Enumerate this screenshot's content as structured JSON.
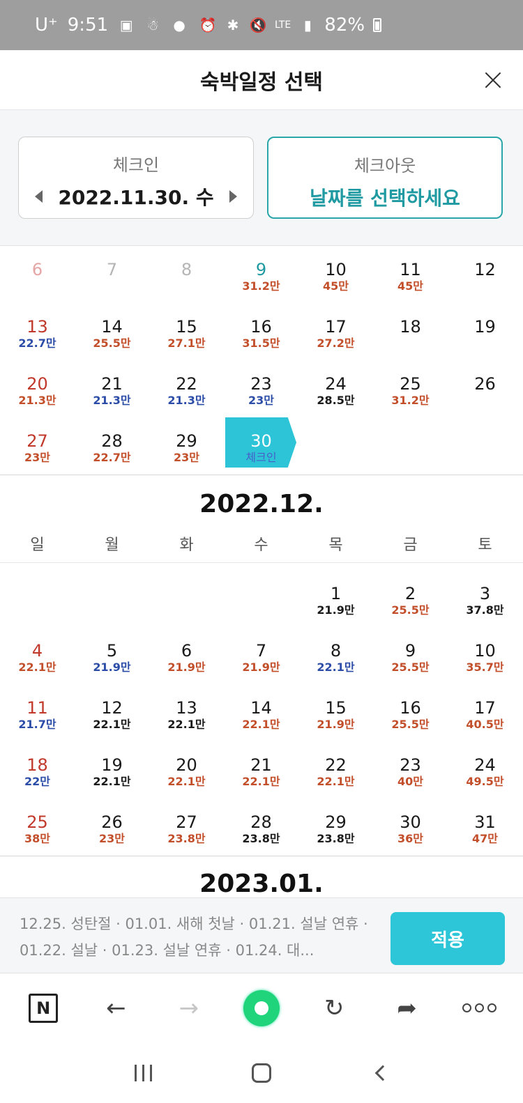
{
  "status_bar": {
    "carrier": "U⁺",
    "time": "9:51",
    "network": "LTE",
    "battery": "82%"
  },
  "header": {
    "title": "숙박일정 선택"
  },
  "checkin": {
    "label": "체크인",
    "value": "2022.11.30. 수"
  },
  "checkout": {
    "label": "체크아웃",
    "value": "날짜를 선택하세요"
  },
  "colors": {
    "accent": "#2dc6d8",
    "teal_text": "#1f9aa2",
    "holiday_red": "#c0392b",
    "price_red": "#c24e2a",
    "price_blue": "#2b4ca7"
  },
  "nov": {
    "weeks": [
      [
        {
          "d": "6",
          "p": "",
          "dc": "c-pink",
          "pc": ""
        },
        {
          "d": "7",
          "p": "",
          "dc": "c-gray",
          "pc": ""
        },
        {
          "d": "8",
          "p": "",
          "dc": "c-gray",
          "pc": ""
        },
        {
          "d": "9",
          "p": "31.2만",
          "dc": "c-teal",
          "pc": "p-red"
        },
        {
          "d": "10",
          "p": "45만",
          "dc": "c-black",
          "pc": "p-red"
        },
        {
          "d": "11",
          "p": "45만",
          "dc": "c-black",
          "pc": "p-red"
        },
        {
          "d": "12",
          "p": "",
          "dc": "c-black",
          "pc": ""
        }
      ],
      [
        {
          "d": "13",
          "p": "22.7만",
          "dc": "c-red",
          "pc": "p-blue"
        },
        {
          "d": "14",
          "p": "25.5만",
          "dc": "c-black",
          "pc": "p-red"
        },
        {
          "d": "15",
          "p": "27.1만",
          "dc": "c-black",
          "pc": "p-red"
        },
        {
          "d": "16",
          "p": "31.5만",
          "dc": "c-black",
          "pc": "p-red"
        },
        {
          "d": "17",
          "p": "27.2만",
          "dc": "c-black",
          "pc": "p-red"
        },
        {
          "d": "18",
          "p": "",
          "dc": "c-black",
          "pc": ""
        },
        {
          "d": "19",
          "p": "",
          "dc": "c-black",
          "pc": ""
        }
      ],
      [
        {
          "d": "20",
          "p": "21.3만",
          "dc": "c-red",
          "pc": "p-red"
        },
        {
          "d": "21",
          "p": "21.3만",
          "dc": "c-black",
          "pc": "p-blue"
        },
        {
          "d": "22",
          "p": "21.3만",
          "dc": "c-black",
          "pc": "p-blue"
        },
        {
          "d": "23",
          "p": "23만",
          "dc": "c-black",
          "pc": "p-blue"
        },
        {
          "d": "24",
          "p": "28.5만",
          "dc": "c-black",
          "pc": "p-black"
        },
        {
          "d": "25",
          "p": "31.2만",
          "dc": "c-black",
          "pc": "p-red"
        },
        {
          "d": "26",
          "p": "",
          "dc": "c-black",
          "pc": ""
        }
      ],
      [
        {
          "d": "27",
          "p": "23만",
          "dc": "c-red",
          "pc": "p-red"
        },
        {
          "d": "28",
          "p": "22.7만",
          "dc": "c-black",
          "pc": "p-red"
        },
        {
          "d": "29",
          "p": "23만",
          "dc": "c-black",
          "pc": "p-red"
        },
        {
          "d": "30",
          "p": "체크인",
          "dc": "c-black",
          "pc": "",
          "selected": true
        },
        {
          "d": "",
          "p": "",
          "dc": "",
          "pc": ""
        },
        {
          "d": "",
          "p": "",
          "dc": "",
          "pc": ""
        },
        {
          "d": "",
          "p": "",
          "dc": "",
          "pc": ""
        }
      ]
    ]
  },
  "dec": {
    "title": "2022.12.",
    "weekdays": [
      "일",
      "월",
      "화",
      "수",
      "목",
      "금",
      "토"
    ],
    "weeks": [
      [
        {
          "d": "",
          "p": "",
          "dc": "",
          "pc": ""
        },
        {
          "d": "",
          "p": "",
          "dc": "",
          "pc": ""
        },
        {
          "d": "",
          "p": "",
          "dc": "",
          "pc": ""
        },
        {
          "d": "",
          "p": "",
          "dc": "",
          "pc": ""
        },
        {
          "d": "1",
          "p": "21.9만",
          "dc": "c-black",
          "pc": "p-black"
        },
        {
          "d": "2",
          "p": "25.5만",
          "dc": "c-black",
          "pc": "p-red"
        },
        {
          "d": "3",
          "p": "37.8만",
          "dc": "c-black",
          "pc": "p-black"
        }
      ],
      [
        {
          "d": "4",
          "p": "22.1만",
          "dc": "c-red",
          "pc": "p-red"
        },
        {
          "d": "5",
          "p": "21.9만",
          "dc": "c-black",
          "pc": "p-blue"
        },
        {
          "d": "6",
          "p": "21.9만",
          "dc": "c-black",
          "pc": "p-red"
        },
        {
          "d": "7",
          "p": "21.9만",
          "dc": "c-black",
          "pc": "p-red"
        },
        {
          "d": "8",
          "p": "22.1만",
          "dc": "c-black",
          "pc": "p-blue"
        },
        {
          "d": "9",
          "p": "25.5만",
          "dc": "c-black",
          "pc": "p-red"
        },
        {
          "d": "10",
          "p": "35.7만",
          "dc": "c-black",
          "pc": "p-red"
        }
      ],
      [
        {
          "d": "11",
          "p": "21.7만",
          "dc": "c-red",
          "pc": "p-blue"
        },
        {
          "d": "12",
          "p": "22.1만",
          "dc": "c-black",
          "pc": "p-black"
        },
        {
          "d": "13",
          "p": "22.1만",
          "dc": "c-black",
          "pc": "p-black"
        },
        {
          "d": "14",
          "p": "22.1만",
          "dc": "c-black",
          "pc": "p-red"
        },
        {
          "d": "15",
          "p": "21.9만",
          "dc": "c-black",
          "pc": "p-red"
        },
        {
          "d": "16",
          "p": "25.5만",
          "dc": "c-black",
          "pc": "p-red"
        },
        {
          "d": "17",
          "p": "40.5만",
          "dc": "c-black",
          "pc": "p-red"
        }
      ],
      [
        {
          "d": "18",
          "p": "22만",
          "dc": "c-red",
          "pc": "p-blue"
        },
        {
          "d": "19",
          "p": "22.1만",
          "dc": "c-black",
          "pc": "p-black"
        },
        {
          "d": "20",
          "p": "22.1만",
          "dc": "c-black",
          "pc": "p-red"
        },
        {
          "d": "21",
          "p": "22.1만",
          "dc": "c-black",
          "pc": "p-red"
        },
        {
          "d": "22",
          "p": "22.1만",
          "dc": "c-black",
          "pc": "p-red"
        },
        {
          "d": "23",
          "p": "40만",
          "dc": "c-black",
          "pc": "p-red"
        },
        {
          "d": "24",
          "p": "49.5만",
          "dc": "c-black",
          "pc": "p-red"
        }
      ],
      [
        {
          "d": "25",
          "p": "38만",
          "dc": "c-red",
          "pc": "p-red"
        },
        {
          "d": "26",
          "p": "23만",
          "dc": "c-black",
          "pc": "p-red"
        },
        {
          "d": "27",
          "p": "23.8만",
          "dc": "c-black",
          "pc": "p-red"
        },
        {
          "d": "28",
          "p": "23.8만",
          "dc": "c-black",
          "pc": "p-black"
        },
        {
          "d": "29",
          "p": "23.8만",
          "dc": "c-black",
          "pc": "p-black"
        },
        {
          "d": "30",
          "p": "36만",
          "dc": "c-black",
          "pc": "p-red"
        },
        {
          "d": "31",
          "p": "47만",
          "dc": "c-black",
          "pc": "p-red"
        }
      ]
    ]
  },
  "next_month_title": "2023.01.",
  "footer": {
    "holidays": "12.25. 성탄절 · 01.01. 새해 첫날 · 01.21. 설날 연휴 · 01.22. 설날 · 01.23. 설날 연휴 · 01.24. 대...",
    "apply_label": "적용"
  },
  "toolbar": {
    "n_label": "N",
    "back": "←",
    "forward": "→",
    "reload": "↻",
    "share": "➦"
  }
}
